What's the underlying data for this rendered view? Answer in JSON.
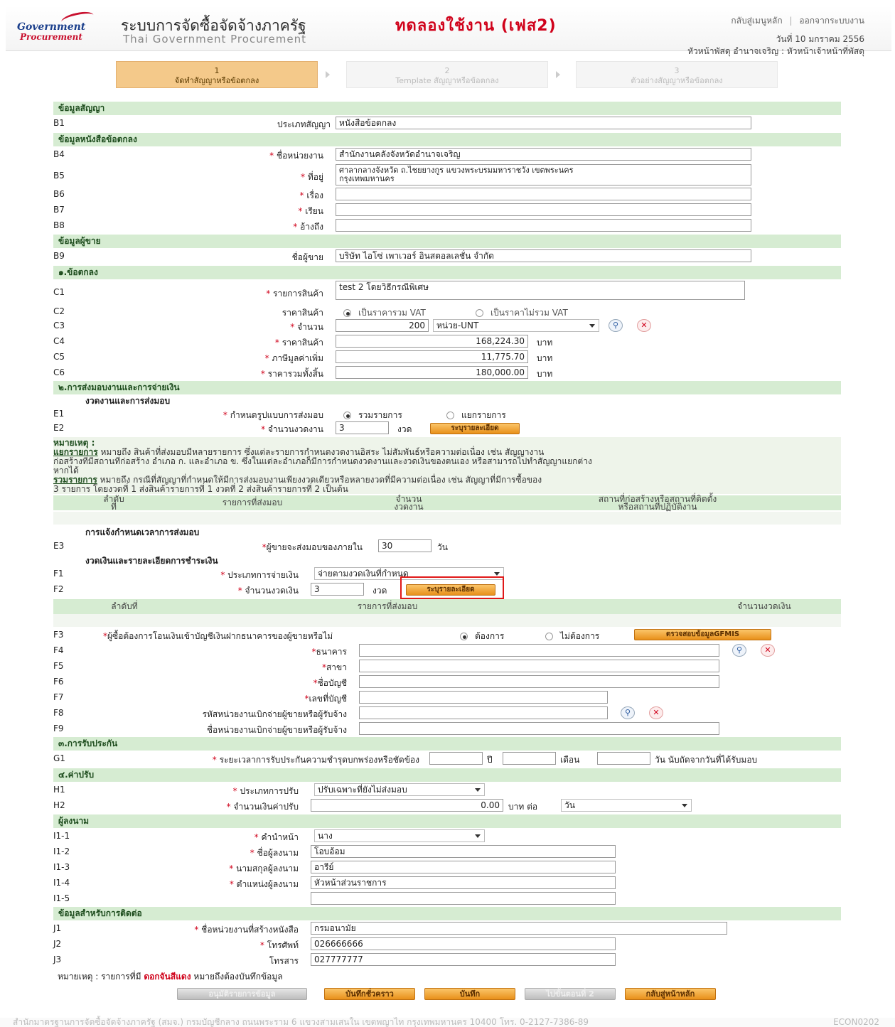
{
  "header": {
    "logo_line1": "Government",
    "logo_line2": "Procurement",
    "title_th": "ระบบการจัดซื้อจัดจ้างภาครัฐ",
    "title_trial": "ทดลองใช้งาน (เฟส2)",
    "title_en": "Thai Government Procurement",
    "link_home": "กลับสู่เมนูหลัก",
    "link_sep": "|",
    "link_logout": "ออกจากระบบงาน",
    "date": "วันที่ 10 มกราคม 2556",
    "user": "หัวหน้าพัสดุ อำนาจเจริญ : หัวหน้าเจ้าหน้าที่พัสดุ"
  },
  "steps": [
    {
      "num": "1",
      "label": "จัดทำสัญญาหรือข้อตกลง"
    },
    {
      "num": "2",
      "label": "Template สัญญาหรือข้อตกลง"
    },
    {
      "num": "3",
      "label": "ตัวอย่างสัญญาหรือข้อตกลง"
    }
  ],
  "sections": {
    "contract": "ข้อมูลสัญญา",
    "agreement": "ข้อมูลหนังสือข้อตกลง",
    "seller": "ข้อมูลผู้ขาย",
    "terms": "๑.ข้อตกลง",
    "delivery": "๒.การส่งมอบงานและการจ่ายเงิน",
    "delivery_sub": "งวดงานและการส่งมอบ",
    "deadline_sub": "การแจ้งกำหนดเวลาการส่งมอบ",
    "payment_sub": "งวดเงินและรายละเอียดการชำระเงิน",
    "warranty": "๓.การรับประกัน",
    "penalty": "๔.ค่าปรับ",
    "signer": "ผู้ลงนาม",
    "contact": "ข้อมูลสำหรับการติดต่อ"
  },
  "fields": {
    "B1": {
      "label": "ประเภทสัญญา",
      "value": "หนังสือข้อตกลง"
    },
    "B4": {
      "label": "ชื่อหน่วยงาน",
      "value": "สำนักงานคลังจังหวัดอำนาจเจริญ"
    },
    "B5": {
      "label": "ที่อยู่",
      "line1": "ศาลากลางจังหวัด ถ.ไชยยางกูร แขวงพระบรมมหาราชวัง เขตพระนคร",
      "line2": "กรุงเทพมหานคร"
    },
    "B6": {
      "label": "เรื่อง",
      "value": ""
    },
    "B7": {
      "label": "เรียน",
      "value": ""
    },
    "B8": {
      "label": "อ้างถึง",
      "value": ""
    },
    "B9": {
      "label": "ชื่อผู้ขาย",
      "value": "บริษัท ไอโซ่ เพาเวอร์ อินสตอลเลชั่น จำกัด"
    },
    "C1": {
      "label": "รายการสินค้า",
      "value": "test 2 โดยวิธีกรณีพิเศษ"
    },
    "C2": {
      "label": "ราคาสินค้า",
      "opt1": "เป็นราคารวม VAT",
      "opt2": "เป็นราคาไม่รวม VAT"
    },
    "C3": {
      "label": "จำนวน",
      "value": "200",
      "unit_sel": "หน่วย-UNT"
    },
    "C4": {
      "label": "ราคาสินค้า",
      "value": "168,224.30",
      "unit": "บาท"
    },
    "C5": {
      "label": "ภาษีมูลค่าเพิ่ม",
      "value": "11,775.70",
      "unit": "บาท"
    },
    "C6": {
      "label": "ราคารวมทั้งสิ้น",
      "value": "180,000.00",
      "unit": "บาท"
    },
    "E1": {
      "label": "กำหนดรูปแบบการส่งมอบ",
      "opt1": "รวมรายการ",
      "opt2": "แยกรายการ"
    },
    "E2": {
      "label": "จำนวนงวดงาน",
      "value": "3",
      "unit": "งวด",
      "btn": "ระบุรายละเอียด"
    },
    "E3": {
      "label": "ผู้ขายจะส่งมอบของภายใน",
      "value": "30",
      "unit": "วัน"
    },
    "F1": {
      "label": "ประเภทการจ่ายเงิน",
      "value": "จ่ายตามงวดเงินที่กำหนด"
    },
    "F2": {
      "label": "จำนวนงวดเงิน",
      "value": "3",
      "unit": "งวด",
      "btn": "ระบุรายละเอียด"
    },
    "F3": {
      "label": "ผู้ซื้อต้องการโอนเงินเข้าบัญชีเงินฝากธนาคารของผู้ขายหรือไม่",
      "opt1": "ต้องการ",
      "opt2": "ไม่ต้องการ",
      "btn": "ตรวจสอบข้อมูลGFMIS"
    },
    "F4": {
      "label": "ธนาคาร",
      "value": ""
    },
    "F5": {
      "label": "สาขา",
      "value": ""
    },
    "F6": {
      "label": "ชื่อบัญชี",
      "value": ""
    },
    "F7": {
      "label": "เลขที่บัญชี",
      "value": ""
    },
    "F8": {
      "label": "รหัสหน่วยงานเบิกจ่ายผู้ขายหรือผู้รับจ้าง",
      "value": ""
    },
    "F9": {
      "label": "ชื่อหน่วยงานเบิกจ่ายผู้ขายหรือผู้รับจ้าง",
      "value": ""
    },
    "G1": {
      "label": "ระยะเวลาการรับประกันความชำรุดบกพร่องหรือชัดข้อง",
      "year": "ปี",
      "month": "เดือน",
      "day": "วัน นับถัดจากวันที่ได้รับมอบ"
    },
    "H1": {
      "label": "ประเภทการปรับ",
      "value": "ปรับเฉพาะที่ยังไม่ส่งมอบ"
    },
    "H2": {
      "label": "จำนวนเงินค่าปรับ",
      "value": "0.00",
      "unit": "บาท ต่อ",
      "per": "วัน"
    },
    "I1_1": {
      "label": "คำนำหน้า",
      "value": "นาง"
    },
    "I1_2": {
      "label": "ชื่อผู้ลงนาม",
      "value": "โอบอ้อม"
    },
    "I1_3": {
      "label": "นามสกุลผู้ลงนาม",
      "value": "อารีย์"
    },
    "I1_4": {
      "label": "ตำแหน่งผู้ลงนาม",
      "value": "หัวหน้าส่วนราชการ"
    },
    "I1_5": {
      "label": "",
      "value": ""
    },
    "J1": {
      "label": "ชื่อหน่วยงานที่สร้างหนังสือ",
      "value": "กรมอนามัย"
    },
    "J2": {
      "label": "โทรศัพท์",
      "value": "026666666"
    },
    "J3": {
      "label": "โทรสาร",
      "value": "027777777"
    }
  },
  "codes": {
    "B1": "B1",
    "B4": "B4",
    "B5": "B5",
    "B6": "B6",
    "B7": "B7",
    "B8": "B8",
    "B9": "B9",
    "C1": "C1",
    "C2": "C2",
    "C3": "C3",
    "C4": "C4",
    "C5": "C5",
    "C6": "C6",
    "E1": "E1",
    "E2": "E2",
    "E3": "E3",
    "F1": "F1",
    "F2": "F2",
    "F3": "F3",
    "F4": "F4",
    "F5": "F5",
    "F6": "F6",
    "F7": "F7",
    "F8": "F8",
    "F9": "F9",
    "G1": "G1",
    "H1": "H1",
    "H2": "H2",
    "I1_1": "I1-1",
    "I1_2": "I1-2",
    "I1_3": "I1-3",
    "I1_4": "I1-4",
    "I1_5": "I1-5",
    "J1": "J1",
    "J2": "J2",
    "J3": "J3"
  },
  "req": "*",
  "note": {
    "head": "หมายเหตุ :",
    "sep_term": "แยกรายการ",
    "sep_text": " หมายถึง สินค้าที่ส่งมอบมีหลายรายการ ซึ่งแต่ละรายการกำหนดงวดงานอิสระ ไม่สัมพันธ์หรือความต่อเนื่อง เช่น สัญญางาน",
    "sep_text2": "ก่อสร้างที่มีสถานที่ก่อสร้าง อำเภอ ก. และอำเภอ ข. ซึ่งในแต่ละอำเภอก็มีการกำหนดงวดงานและงวดเงินของตนเอง หรือสามารถไปทำสัญญาแยกต่าง",
    "sep_text3": "หากได้",
    "com_term": "รวมรายการ",
    "com_text": " หมายถึง กรณีที่สัญญาที่กำหนดให้มีการส่งมอบงานเพียงงวดเดียวหรือหลายงวดที่มีความต่อเนื่อง เช่น สัญญาที่มีการซื้อของ",
    "com_text2": "3 รายการ โดยงวดที่ 1 ส่งสินค้ารายการที่ 1 งวดที่ 2 ส่งสินค้ารายการที่ 2 เป็นต้น"
  },
  "table1": {
    "h1a": "ลำดับ",
    "h1b": "ที่",
    "h2": "รายการที่ส่งมอบ",
    "h3a": "จำนวน",
    "h3b": "งวดงาน",
    "h4a": "สถานที่ก่อสร้างหรือสถานที่ติดตั้ง",
    "h4b": "หรือสถานที่ปฏิบัติงาน"
  },
  "table2": {
    "h1": "ลำดับที่",
    "h2": "รายการที่ส่งมอบ",
    "h3": "จำนวนงวดเงิน"
  },
  "footnote": {
    "pre": "หมายเหตุ : รายการที่มี ",
    "red": "ดอกจันสีแดง",
    "post": " หมายถึงต้องบันทึกข้อมูล"
  },
  "buttons": {
    "approve": "อนุมัติรายการข้อมูล",
    "draft": "บันทึกชั่วคราว",
    "save": "บันทึก",
    "next": "ไปขั้นตอนที่ 2",
    "back": "กลับสู่หน้าหลัก"
  },
  "footer": {
    "text": "สำนักมาตรฐานการจัดซื้อจัดจ้างภาครัฐ (สมจ.) กรมบัญชีกลาง ถนนพระราม 6 แขวงสามเสนใน เขตพญาไท กรุงเทพมหานคร 10400 โทร. 0-2127-7386-89",
    "code": "ECON0202"
  },
  "icons": {
    "search": "magnifier-icon",
    "clear": "clear-x-icon"
  },
  "colors": {
    "section_bg": "#d6ecd2",
    "required": "#d0021b",
    "button": "#e8901a",
    "highlight": "#e01818"
  }
}
